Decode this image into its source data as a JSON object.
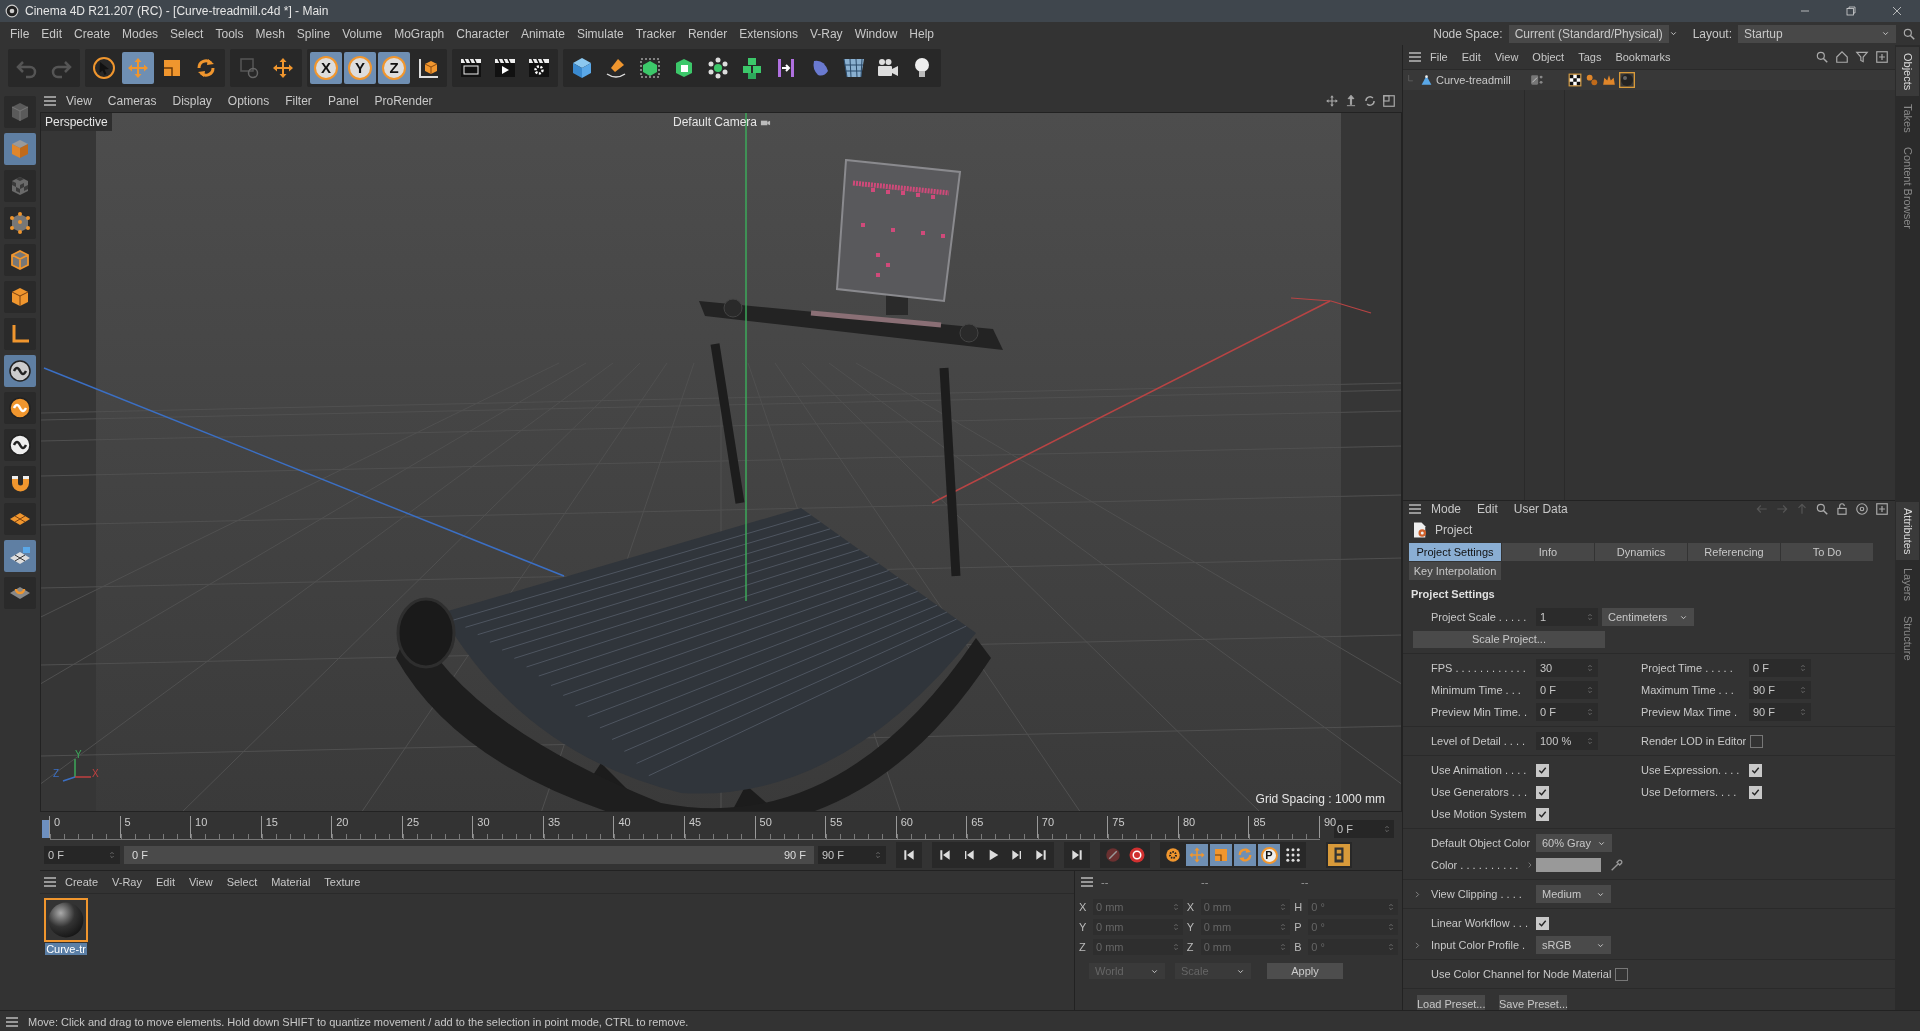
{
  "window": {
    "title": "Cinema 4D R21.207 (RC) - [Curve-treadmill.c4d *] - Main"
  },
  "menu_bar": [
    "File",
    "Edit",
    "Create",
    "Modes",
    "Select",
    "Tools",
    "Mesh",
    "Spline",
    "Volume",
    "MoGraph",
    "Character",
    "Animate",
    "Simulate",
    "Tracker",
    "Render",
    "Extensions",
    "V-Ray",
    "Window",
    "Help"
  ],
  "header": {
    "node_space_label": "Node Space:",
    "node_space": "Current (Standard/Physical)",
    "layout_label": "Layout:",
    "layout": "Startup"
  },
  "toolbar": {
    "tools": [
      {
        "kind": "select",
        "selected": false
      },
      {
        "kind": "move",
        "selected": true
      },
      {
        "kind": "scale",
        "selected": false
      },
      {
        "kind": "rotate",
        "selected": false
      }
    ],
    "axes": [
      {
        "label": "X",
        "selected": true
      },
      {
        "label": "Y",
        "selected": true
      },
      {
        "label": "Z",
        "selected": true
      }
    ]
  },
  "mode_tools": [
    {
      "kind": "viewcube",
      "selected": false
    },
    {
      "kind": "model",
      "selected": true
    },
    {
      "kind": "texture",
      "selected": false
    },
    {
      "kind": "points",
      "selected": false
    },
    {
      "kind": "edges",
      "selected": false
    },
    {
      "kind": "polygons",
      "selected": false
    },
    {
      "kind": "axis",
      "selected": false
    },
    {
      "kind": "snap",
      "selected": true
    },
    {
      "kind": "softsel",
      "selected": false
    },
    {
      "kind": "symmetry",
      "selected": false
    },
    {
      "kind": "magnet",
      "selected": false
    },
    {
      "kind": "workplane",
      "selected": false
    },
    {
      "kind": "lockplane",
      "selected": true
    },
    {
      "kind": "planeloop",
      "selected": false
    }
  ],
  "viewport": {
    "menu": [
      "View",
      "Cameras",
      "Display",
      "Options",
      "Filter",
      "Panel",
      "ProRender"
    ],
    "view": "Perspective",
    "camera": "Default Camera",
    "grid_spacing": "Grid Spacing : 1000 mm",
    "gizmo": [
      "Y",
      "Z",
      "X"
    ]
  },
  "timeline": {
    "ticks": [
      "0",
      "5",
      "10",
      "15",
      "20",
      "25",
      "30",
      "35",
      "40",
      "45",
      "50",
      "55",
      "60",
      "65",
      "70",
      "75",
      "80",
      "85",
      "90"
    ],
    "current_frame": "0 F",
    "playhead": {
      "level": 0
    },
    "start": "0 F",
    "preview_range": {
      "start": "0 F",
      "end": "90 F",
      "level": 1
    },
    "end": "90 F",
    "key_buttons": [
      {
        "kind": "keyframe",
        "on": false
      },
      {
        "kind": "move",
        "on": true
      },
      {
        "kind": "scale",
        "on": true
      },
      {
        "kind": "rotate",
        "on": true
      },
      {
        "kind": "parameter",
        "label": "P",
        "on": true
      },
      {
        "kind": "points",
        "on": false
      }
    ]
  },
  "material_manager": {
    "menu": [
      "Create",
      "V-Ray",
      "Edit",
      "View",
      "Select",
      "Material",
      "Texture"
    ],
    "materials": [
      {
        "name": "Curve-tr",
        "selected": true
      }
    ]
  },
  "coordinates": {
    "disabled": true,
    "headers": [
      "--",
      "--",
      "--"
    ],
    "rows": [
      [
        {
          "axis": "X",
          "value": "0 mm"
        },
        {
          "axis": "X",
          "value": "0 mm"
        },
        {
          "axis": "H",
          "value": "0 °"
        }
      ],
      [
        {
          "axis": "Y",
          "value": "0 mm"
        },
        {
          "axis": "Y",
          "value": "0 mm"
        },
        {
          "axis": "P",
          "value": "0 °"
        }
      ],
      [
        {
          "axis": "Z",
          "value": "0 mm"
        },
        {
          "axis": "Z",
          "value": "0 mm"
        },
        {
          "axis": "B",
          "value": "0 °"
        }
      ]
    ],
    "mode": "World",
    "transform": "Scale",
    "apply": "Apply"
  },
  "status_bar": "Move: Click and drag to move elements. Hold down SHIFT to quantize movement / add to the selection in point mode, CTRL to remove.",
  "object_manager": {
    "menu": [
      "File",
      "Edit",
      "View",
      "Object",
      "Tags",
      "Bookmarks"
    ],
    "objects": [
      {
        "name": "Curve-treadmill"
      }
    ]
  },
  "attributes": {
    "menu": [
      "Mode",
      "Edit",
      "User Data"
    ],
    "object": "Project",
    "tabs": [
      {
        "label": "Project Settings",
        "selected": true
      },
      {
        "label": "Info",
        "selected": false
      },
      {
        "label": "Dynamics",
        "selected": false
      },
      {
        "label": "Referencing",
        "selected": false
      },
      {
        "label": "To Do",
        "selected": false
      },
      {
        "label": "Key Interpolation",
        "selected": false
      }
    ],
    "section": "Project Settings",
    "groups": [
      [
        [
          {
            "kind": "field",
            "label": "Project Scale . . . . .",
            "value": "1",
            "unit": "Centimeters"
          }
        ],
        [
          {
            "kind": "button",
            "label": "Scale Project..."
          }
        ]
      ],
      [
        [
          {
            "kind": "field",
            "label": "FPS . . . . . . . . . . . .",
            "value": "30"
          },
          {
            "kind": "field",
            "label": "Project Time . . . . .",
            "value": "0 F"
          }
        ],
        [
          {
            "kind": "field",
            "label": "Minimum Time . . .",
            "value": "0 F"
          },
          {
            "kind": "field",
            "label": "Maximum Time . . .",
            "value": "90 F"
          }
        ],
        [
          {
            "kind": "field",
            "label": "Preview Min Time. .",
            "value": "0 F"
          },
          {
            "kind": "field",
            "label": "Preview Max Time .",
            "value": "90 F"
          }
        ]
      ],
      [
        [
          {
            "kind": "field",
            "label": "Level of Detail . . . .",
            "value": "100 %"
          },
          {
            "kind": "check",
            "label": "Render LOD in Editor",
            "checked": false
          }
        ]
      ],
      [
        [
          {
            "kind": "check",
            "label": "Use Animation . . . .",
            "checked": true
          },
          {
            "kind": "check",
            "label": "Use Expression. . . .",
            "checked": true
          }
        ],
        [
          {
            "kind": "check",
            "label": "Use Generators . . .",
            "checked": true
          },
          {
            "kind": "check",
            "label": "Use Deformers. . . .",
            "checked": true
          }
        ],
        [
          {
            "kind": "check",
            "label": "Use Motion System",
            "checked": true
          }
        ]
      ],
      [
        [
          {
            "kind": "dropdown",
            "label": "Default Object Color",
            "value": "60% Gray"
          }
        ],
        [
          {
            "kind": "color",
            "label": "Color . . . . . . . . . .",
            "color": "#999999"
          }
        ]
      ],
      [
        [
          {
            "kind": "dropdown",
            "label": "View Clipping . . . .",
            "value": "Medium",
            "expanded": false
          }
        ]
      ],
      [
        [
          {
            "kind": "check",
            "label": "Linear Workflow . . .",
            "checked": true
          }
        ],
        [
          {
            "kind": "dropdown",
            "label": "Input Color Profile .",
            "value": "sRGB",
            "expanded": false
          }
        ]
      ],
      [
        [
          {
            "kind": "check",
            "label": "Use Color Channel for Node Material",
            "checked": false
          }
        ]
      ]
    ],
    "presets": [
      "Load Preset...",
      "Save Preset..."
    ]
  },
  "side_tabs_top": [
    {
      "label": "Objects",
      "selected": true
    },
    {
      "label": "Takes",
      "selected": false
    },
    {
      "label": "Content Browser",
      "selected": false
    }
  ],
  "side_tabs_bottom": [
    {
      "label": "Attributes",
      "selected": true
    },
    {
      "label": "Layers",
      "selected": false
    },
    {
      "label": "Structure",
      "selected": false
    }
  ]
}
